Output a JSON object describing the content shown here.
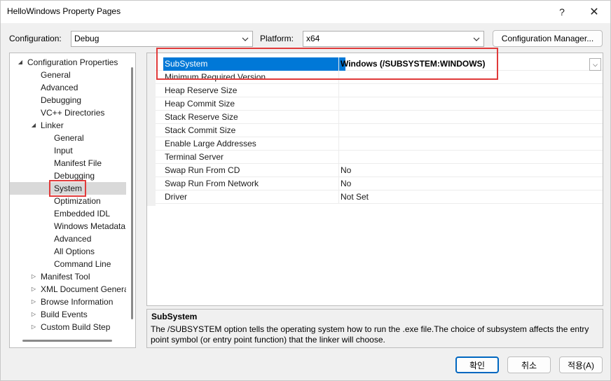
{
  "window": {
    "title": "HelloWindows Property Pages",
    "help_glyph": "?",
    "close_glyph": "✕"
  },
  "toolbar": {
    "configuration_label": "Configuration:",
    "configuration_value": "Debug",
    "platform_label": "Platform:",
    "platform_value": "x64",
    "config_manager_label": "Configuration Manager..."
  },
  "tree": {
    "items": [
      {
        "label": "Configuration Properties",
        "level": 0,
        "expander": "◢",
        "selected": false
      },
      {
        "label": "General",
        "level": 1,
        "expander": "",
        "selected": false
      },
      {
        "label": "Advanced",
        "level": 1,
        "expander": "",
        "selected": false
      },
      {
        "label": "Debugging",
        "level": 1,
        "expander": "",
        "selected": false
      },
      {
        "label": "VC++ Directories",
        "level": 1,
        "expander": "",
        "selected": false
      },
      {
        "label": "Linker",
        "level": 1,
        "expander": "◢",
        "selected": false
      },
      {
        "label": "General",
        "level": 2,
        "expander": "",
        "selected": false
      },
      {
        "label": "Input",
        "level": 2,
        "expander": "",
        "selected": false
      },
      {
        "label": "Manifest File",
        "level": 2,
        "expander": "",
        "selected": false
      },
      {
        "label": "Debugging",
        "level": 2,
        "expander": "",
        "selected": false
      },
      {
        "label": "System",
        "level": 2,
        "expander": "",
        "selected": true
      },
      {
        "label": "Optimization",
        "level": 2,
        "expander": "",
        "selected": false
      },
      {
        "label": "Embedded IDL",
        "level": 2,
        "expander": "",
        "selected": false
      },
      {
        "label": "Windows Metadata",
        "level": 2,
        "expander": "",
        "selected": false
      },
      {
        "label": "Advanced",
        "level": 2,
        "expander": "",
        "selected": false
      },
      {
        "label": "All Options",
        "level": 2,
        "expander": "",
        "selected": false
      },
      {
        "label": "Command Line",
        "level": 2,
        "expander": "",
        "selected": false
      },
      {
        "label": "Manifest Tool",
        "level": 1,
        "expander": "▷",
        "selected": false
      },
      {
        "label": "XML Document Generator",
        "level": 1,
        "expander": "▷",
        "selected": false
      },
      {
        "label": "Browse Information",
        "level": 1,
        "expander": "▷",
        "selected": false
      },
      {
        "label": "Build Events",
        "level": 1,
        "expander": "▷",
        "selected": false
      },
      {
        "label": "Custom Build Step",
        "level": 1,
        "expander": "▷",
        "selected": false
      }
    ]
  },
  "grid": {
    "dropdown_glyph": "⌵",
    "rows": [
      {
        "name": "SubSystem",
        "value": "Windows (/SUBSYSTEM:WINDOWS)",
        "selected": true
      },
      {
        "name": "Minimum Required Version",
        "value": "",
        "selected": false
      },
      {
        "name": "Heap Reserve Size",
        "value": "",
        "selected": false
      },
      {
        "name": "Heap Commit Size",
        "value": "",
        "selected": false
      },
      {
        "name": "Stack Reserve Size",
        "value": "",
        "selected": false
      },
      {
        "name": "Stack Commit Size",
        "value": "",
        "selected": false
      },
      {
        "name": "Enable Large Addresses",
        "value": "",
        "selected": false
      },
      {
        "name": "Terminal Server",
        "value": "",
        "selected": false
      },
      {
        "name": "Swap Run From CD",
        "value": "No",
        "selected": false
      },
      {
        "name": "Swap Run From Network",
        "value": "No",
        "selected": false
      },
      {
        "name": "Driver",
        "value": "Not Set",
        "selected": false
      }
    ]
  },
  "description": {
    "title": "SubSystem",
    "text": "The /SUBSYSTEM option tells the operating system how to run the .exe file.The choice of subsystem affects the entry point symbol (or entry point function) that the linker will choose."
  },
  "buttons": {
    "ok_label": "확인",
    "cancel_label": "취소",
    "apply_label": "적용(A)"
  },
  "colors": {
    "selection": "#0078d7",
    "tree_selected": "#d9d9d9",
    "highlight_red": "#e03a3a",
    "primary_border": "#0067c0"
  }
}
